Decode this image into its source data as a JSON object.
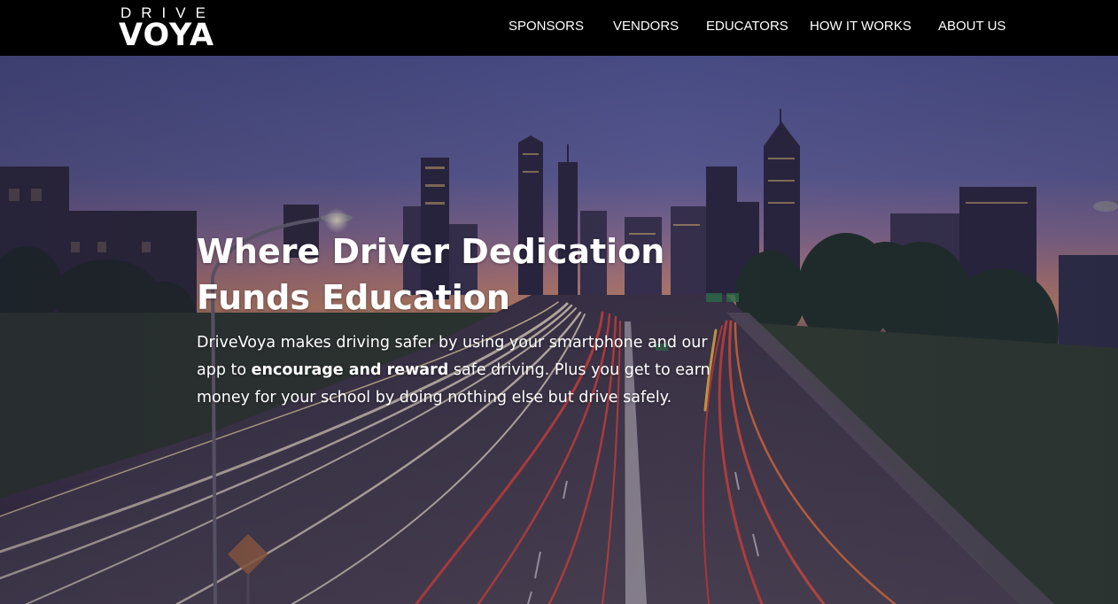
{
  "header": {
    "logo_top": "DRIVE",
    "logo_bottom": "VOYA",
    "nav": [
      {
        "label": "SPONSORS"
      },
      {
        "label": "VENDORS"
      },
      {
        "label": "EDUCATORS"
      },
      {
        "label": "HOW IT WORKS"
      },
      {
        "label": "ABOUT US"
      }
    ]
  },
  "hero": {
    "title_line1": "Where Driver Dedication",
    "title_line2": "Funds Education",
    "text_part1": "DriveVoya makes driving safer by using your smartphone and our app to ",
    "text_bold": "encourage and reward",
    "text_part2": " safe driving. Plus you get to earn money for your school by doing nothing else but drive safely."
  },
  "colors": {
    "header_bg": "#000000",
    "text": "#ffffff",
    "sky_top": "#5b5f9a",
    "sky_horizon": "#c9866c",
    "light_trail_red": "#e0453d",
    "light_trail_white": "#f3e9d2"
  }
}
